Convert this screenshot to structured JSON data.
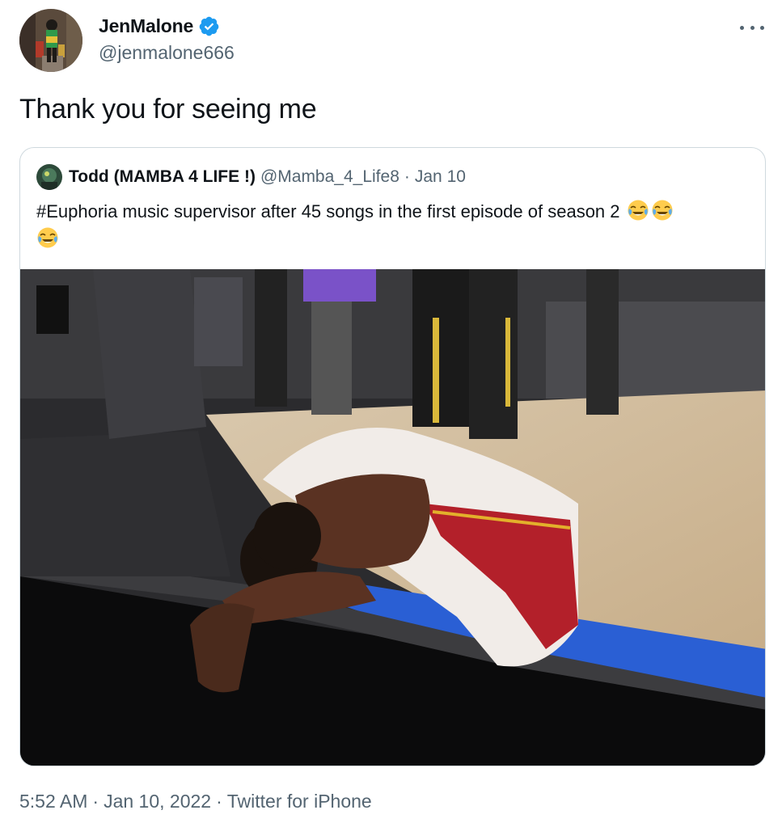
{
  "tweet": {
    "author": {
      "display_name": "JenMalone",
      "handle": "@jenmalone666",
      "verified": true,
      "avatar_icon": "profile-photo"
    },
    "text": "Thank you for seeing me",
    "more_icon": "ellipsis-icon",
    "quoted": {
      "display_name": "Todd (MAMBA 4 LIFE !)",
      "handle": "@Mamba_4_Life8",
      "separator": "·",
      "date": "Jan 10",
      "text": "#Euphoria music supervisor after 45 songs in the first episode of season 2",
      "emoji": [
        "face-with-tears-of-joy",
        "face-with-tears-of-joy",
        "face-with-tears-of-joy"
      ],
      "media_description_icon": "basketball-player-photo"
    },
    "footer": {
      "time": "5:52 AM",
      "separator": "·",
      "date": "Jan 10, 2022",
      "source": "Twitter for iPhone"
    },
    "colors": {
      "verified_blue": "#1d9bf0",
      "secondary_text": "#536471",
      "border": "#cfd9de"
    }
  }
}
